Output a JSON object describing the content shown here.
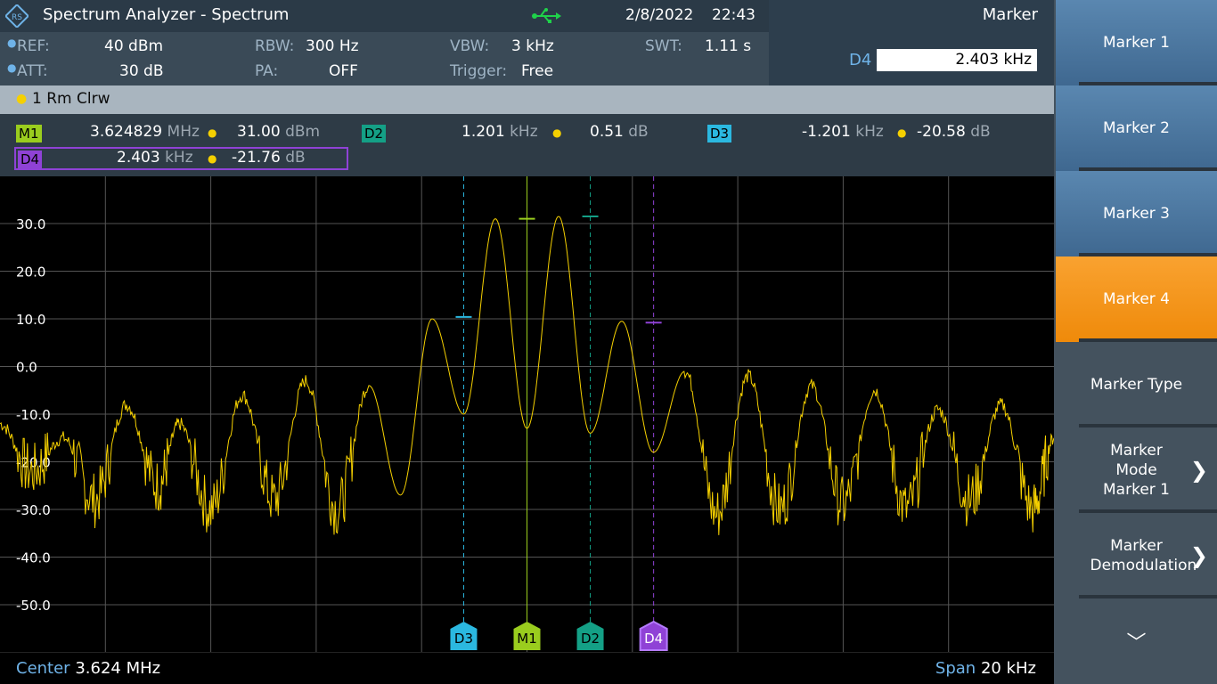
{
  "header": {
    "title": "Spectrum Analyzer - Spectrum",
    "date": "2/8/2022",
    "time": "22:43",
    "panel_title": "Marker",
    "active_marker_label": "D4",
    "active_marker_value": "2.403 kHz"
  },
  "params": {
    "ref_label": "REF:",
    "ref_value": "40 dBm",
    "att_label": "ATT:",
    "att_value": "30 dB",
    "rbw_label": "RBW:",
    "rbw_value": "300 Hz",
    "pa_label": "PA:",
    "pa_value": "OFF",
    "vbw_label": "VBW:",
    "vbw_value": "3 kHz",
    "trigger_label": "Trigger:",
    "trigger_value": "Free",
    "swt_label": "SWT:",
    "swt_value": "1.11 s"
  },
  "trace": {
    "label": "1 Rm  Clrw",
    "color": "#f5d000"
  },
  "markers": [
    {
      "id": "M1",
      "x": "3.624829",
      "x_unit": "MHz",
      "y": "31.00",
      "y_unit": "dBm",
      "color": "#9acd1e"
    },
    {
      "id": "D2",
      "x": "1.201",
      "x_unit": "kHz",
      "y": "0.51",
      "y_unit": "dB",
      "color": "#14a086"
    },
    {
      "id": "D3",
      "x": "-1.201",
      "x_unit": "kHz",
      "y": "-20.58",
      "y_unit": "dB",
      "color": "#2bb8e0"
    },
    {
      "id": "D4",
      "x": "2.403",
      "x_unit": "kHz",
      "y": "-21.76",
      "y_unit": "dB",
      "color": "#8f42d6"
    }
  ],
  "chart_data": {
    "type": "line",
    "ytick_labels": [
      "30.0",
      "20.0",
      "10.0",
      "0.0",
      "-10.0",
      "-20.0",
      "-30.0",
      "-40.0",
      "-50.0"
    ],
    "yticks": [
      30,
      20,
      10,
      0,
      -10,
      -20,
      -30,
      -40,
      -50
    ],
    "ylim": [
      -60,
      40
    ],
    "x_center_mhz": 3.624,
    "x_span_khz": 20,
    "xlim_khz": [
      -10,
      10
    ],
    "grid": true,
    "series": [
      {
        "x_khz": [
          -10,
          -9.4,
          -8.8,
          -8.2,
          -7.6,
          -7.0,
          -6.6,
          -6.0,
          -5.4,
          -4.8,
          -4.2,
          -3.6,
          -3.0,
          -2.4,
          -1.8,
          -1.2,
          -0.6,
          0.0,
          0.6,
          1.2,
          1.8,
          2.4,
          3.0,
          3.6,
          4.2,
          4.8,
          5.4,
          6.0,
          6.6,
          7.2,
          7.8,
          8.4,
          9.0,
          9.6,
          10
        ],
        "y_db": [
          -12,
          -22,
          -15,
          -28,
          -8,
          -25,
          -12,
          -30,
          -6,
          -28,
          -3,
          -30,
          -4,
          -27,
          10,
          -10,
          31,
          -13,
          31.5,
          -14,
          9.5,
          -18,
          -1,
          -31,
          -2,
          -30,
          -4,
          -29,
          -5,
          -30,
          -9,
          -28,
          -8,
          -30,
          -15
        ]
      }
    ],
    "marker_positions_khz": {
      "D3": -1.201,
      "M1": 0.0,
      "D2": 1.201,
      "D4": 2.403
    },
    "marker_levels_db": {
      "D3": 10.4,
      "M1": 31.0,
      "D2": 31.5,
      "D4": 9.2
    }
  },
  "footer": {
    "center_label": "Center",
    "center_value": "3.624 MHz",
    "span_label": "Span",
    "span_value": "20 kHz"
  },
  "softkeys": [
    {
      "label": "Marker 1",
      "style": "blue"
    },
    {
      "label": "Marker 2",
      "style": "blue"
    },
    {
      "label": "Marker 3",
      "style": "blue"
    },
    {
      "label": "Marker 4",
      "style": "active"
    },
    {
      "label": "Marker Type",
      "style": "plain"
    },
    {
      "label": "Marker Mode Marker 1",
      "style": "plain",
      "chevron": true
    },
    {
      "label": "Marker Demodulation",
      "style": "plain",
      "chevron": true
    }
  ],
  "icons": {
    "logo": "rs-logo-icon",
    "usb": "usb-icon",
    "more": "chevron-down-icon",
    "submenu": "chevron-right-icon"
  }
}
